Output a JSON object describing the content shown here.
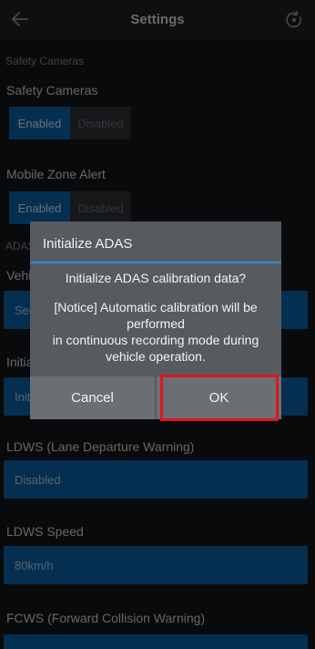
{
  "header": {
    "title": "Settings",
    "back_icon": "back-arrow-icon",
    "right_icon": "refresh-icon"
  },
  "sections": {
    "safety_cameras_header": "Safety Cameras",
    "adas_header_partial": "ADAS"
  },
  "safety_cameras": {
    "label": "Safety Cameras",
    "enabled": "Enabled",
    "disabled": "Disabled",
    "selected": "Enabled"
  },
  "mobile_zone_alert": {
    "label": "Mobile Zone Alert",
    "enabled": "Enabled",
    "disabled": "Disabled",
    "selected": "Enabled"
  },
  "vehicle_partial": {
    "label": "Vehi",
    "value": "Sec"
  },
  "initialize_partial": {
    "label": "Initia",
    "value": "Init"
  },
  "ldws": {
    "label": "LDWS (Lane Departure Warning)",
    "value": "Disabled"
  },
  "ldws_speed": {
    "label": "LDWS Speed",
    "value": "80km/h"
  },
  "fcws": {
    "label": "FCWS (Forward Collision Warning)"
  },
  "dialog": {
    "title": "Initialize ADAS",
    "message": "Initialize ADAS calibration data?",
    "notice_line1": "[Notice] Automatic calibration will be",
    "notice_line2": "performed",
    "notice_line3": "in continuous recording mode during",
    "notice_line4": "vehicle operation.",
    "cancel": "Cancel",
    "ok": "OK"
  },
  "colors": {
    "accent": "#0a5fa0",
    "divider": "#2d8bd6",
    "highlight": "#e0161b"
  }
}
